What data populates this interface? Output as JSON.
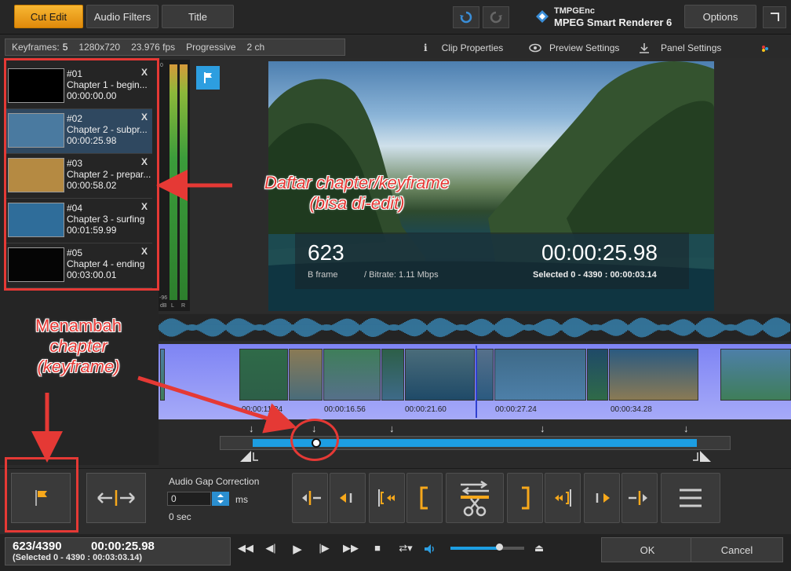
{
  "toolbar": {
    "tabs": [
      {
        "label": "Cut Edit",
        "active": true
      },
      {
        "label": "Audio Filters",
        "active": false
      },
      {
        "label": "Title",
        "active": false
      }
    ],
    "brand_line1": "TMPGEnc",
    "brand_line2": "MPEG Smart Renderer 6",
    "options_label": "Options"
  },
  "info": {
    "keyframes_label": "Keyframes:",
    "keyframes_count": "5",
    "resolution": "1280x720",
    "fps": "23.976 fps",
    "scan": "Progressive",
    "channels": "2 ch",
    "clip_properties": "Clip Properties",
    "preview_settings": "Preview Settings",
    "panel_settings": "Panel Settings"
  },
  "chapters": [
    {
      "num": "#01",
      "title": "Chapter 1 - begin...",
      "time": "00:00:00.00",
      "thumb": "#000000",
      "selected": false
    },
    {
      "num": "#02",
      "title": "Chapter 2 - subpr...",
      "time": "00:00:25.98",
      "thumb": "#4a7aa0",
      "selected": true
    },
    {
      "num": "#03",
      "title": "Chapter 2 - prepar...",
      "time": "00:00:58.02",
      "thumb": "#b58a42",
      "selected": false
    },
    {
      "num": "#04",
      "title": "Chapter 3 - surfing",
      "time": "00:01:59.99",
      "thumb": "#2f6d9a",
      "selected": false
    },
    {
      "num": "#05",
      "title": "Chapter 4 - ending",
      "time": "00:03:00.01",
      "thumb": "#050505",
      "selected": false
    }
  ],
  "vu": {
    "top_label": "0",
    "bottom_label": "-96",
    "dB": "dB",
    "L": "L",
    "R": "R"
  },
  "preview": {
    "frame_number": "623",
    "frame_type": "B frame",
    "bitrate": "/ Bitrate: 1.11 Mbps",
    "time": "00:00:25.98",
    "selection": "Selected 0 - 4390 : 00:00:03.14"
  },
  "filmstrip": {
    "times": [
      "00:00:11.34",
      "00:00:16.56",
      "00:00:21.60",
      "00:00:27.24",
      "00:00:34.28"
    ]
  },
  "audio_gap": {
    "label": "Audio Gap Correction",
    "value": "0",
    "unit": "ms",
    "seconds": "0 sec"
  },
  "status": {
    "position": "623/4390",
    "time": "00:00:25.98",
    "selection": "(Selected 0 - 4390 : 00:03:03.14)",
    "volume_level": 0.66
  },
  "buttons": {
    "ok": "OK",
    "cancel": "Cancel"
  },
  "annotations": {
    "list_note_line1": "Daftar chapter/keyframe",
    "list_note_line2": "(bisa di-edit)",
    "add_note_line1": "Menambah",
    "add_note_line2": "chapter",
    "add_note_line3": "(keyframe)"
  },
  "colors": {
    "accent": "#f7a81b",
    "highlight": "#1d9ee2",
    "annotation": "#e53935"
  }
}
